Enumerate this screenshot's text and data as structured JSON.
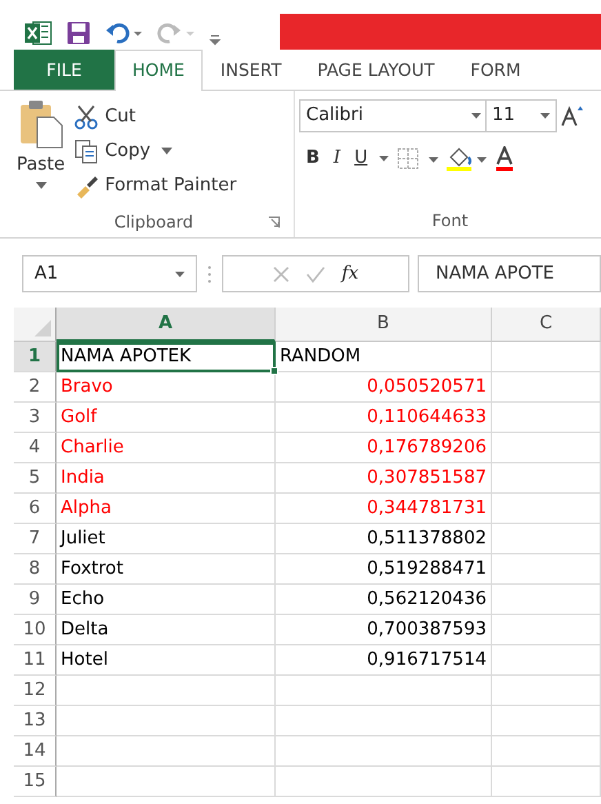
{
  "quick_access": {
    "undo_enabled": true,
    "redo_enabled": false
  },
  "tabs": [
    {
      "label": "FILE",
      "kind": "file",
      "selected": false
    },
    {
      "label": "HOME",
      "kind": "tab",
      "selected": true
    },
    {
      "label": "INSERT",
      "kind": "tab",
      "selected": false
    },
    {
      "label": "PAGE LAYOUT",
      "kind": "tab",
      "selected": false
    },
    {
      "label": "FORM",
      "kind": "tab",
      "selected": false
    }
  ],
  "clipboard": {
    "paste": "Paste",
    "cut": "Cut",
    "copy": "Copy",
    "format_painter": "Format Painter",
    "group_label": "Clipboard"
  },
  "font_group": {
    "font_name": "Calibri",
    "font_size": "11",
    "bold": "B",
    "italic": "I",
    "underline": "U",
    "group_label": "Font"
  },
  "formula_bar": {
    "name_box": "A1",
    "fx": "fx",
    "content": "NAMA APOTE"
  },
  "columns": [
    {
      "label": "A",
      "selected": true
    },
    {
      "label": "B",
      "selected": false
    },
    {
      "label": "C",
      "selected": false
    }
  ],
  "rows": [
    {
      "number": "1",
      "selected": true,
      "a": "NAMA APOTEK",
      "b": "RANDOM",
      "kind": "header",
      "color": "#000000"
    },
    {
      "number": "2",
      "selected": false,
      "a": "Bravo",
      "b": "0,050520571",
      "kind": "data",
      "color": "#ff0000"
    },
    {
      "number": "3",
      "selected": false,
      "a": "Golf",
      "b": "0,110644633",
      "kind": "data",
      "color": "#ff0000"
    },
    {
      "number": "4",
      "selected": false,
      "a": "Charlie",
      "b": "0,176789206",
      "kind": "data",
      "color": "#ff0000"
    },
    {
      "number": "5",
      "selected": false,
      "a": "India",
      "b": "0,307851587",
      "kind": "data",
      "color": "#ff0000"
    },
    {
      "number": "6",
      "selected": false,
      "a": "Alpha",
      "b": "0,344781731",
      "kind": "data",
      "color": "#ff0000"
    },
    {
      "number": "7",
      "selected": false,
      "a": "Juliet",
      "b": "0,511378802",
      "kind": "data",
      "color": "#000000"
    },
    {
      "number": "8",
      "selected": false,
      "a": "Foxtrot",
      "b": "0,519288471",
      "kind": "data",
      "color": "#000000"
    },
    {
      "number": "9",
      "selected": false,
      "a": "Echo",
      "b": "0,562120436",
      "kind": "data",
      "color": "#000000"
    },
    {
      "number": "10",
      "selected": false,
      "a": "Delta",
      "b": "0,700387593",
      "kind": "data",
      "color": "#000000"
    },
    {
      "number": "11",
      "selected": false,
      "a": "Hotel",
      "b": "0,916717514",
      "kind": "data",
      "color": "#000000"
    },
    {
      "number": "12",
      "selected": false
    },
    {
      "number": "13",
      "selected": false
    },
    {
      "number": "14",
      "selected": false
    },
    {
      "number": "15",
      "selected": false
    }
  ]
}
